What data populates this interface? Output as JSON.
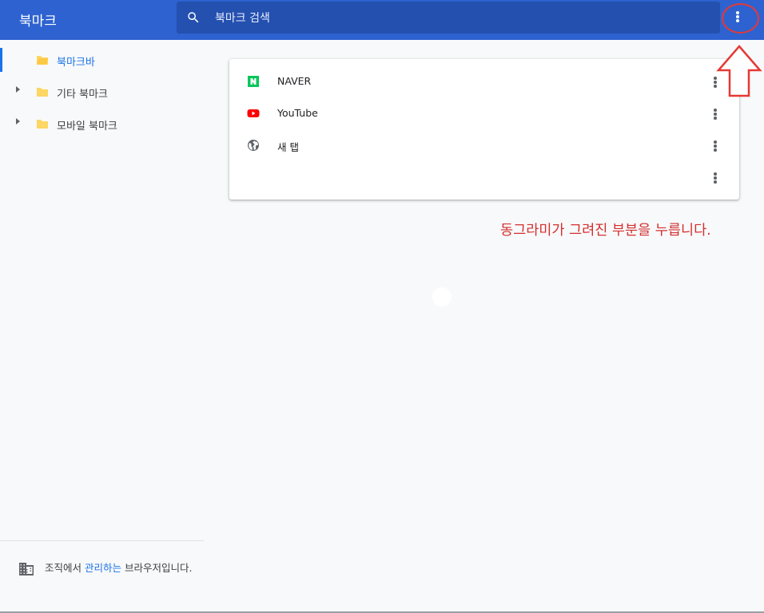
{
  "header": {
    "title": "북마크",
    "search_placeholder": "북마크 검색",
    "more_icon": "more-vert-icon"
  },
  "sidebar": {
    "items": [
      {
        "label": "북마크바",
        "icon": "folder-open-icon",
        "selected": true,
        "expandable": false
      },
      {
        "label": "기타 북마크",
        "icon": "folder-icon",
        "selected": false,
        "expandable": true
      },
      {
        "label": "모바일 북마크",
        "icon": "folder-icon",
        "selected": false,
        "expandable": true
      }
    ],
    "managed": {
      "icon": "building-icon",
      "text_before": "조직에서 ",
      "link": "관리하는",
      "text_after": " 브라우저입니다."
    }
  },
  "bookmarks": [
    {
      "label": "NAVER",
      "icon": "naver-favicon"
    },
    {
      "label": "YouTube",
      "icon": "youtube-favicon"
    },
    {
      "label": "새 탭",
      "icon": "globe-icon"
    },
    {
      "label": "",
      "icon": ""
    }
  ],
  "annotation": {
    "text": "동그라미가 그려진 부분을 누릅니다."
  },
  "colors": {
    "header": "#2e62d0",
    "search": "#2450b0",
    "accent": "#1a73e8",
    "folder": "#fdd663",
    "annotation": "#d32f2f"
  }
}
